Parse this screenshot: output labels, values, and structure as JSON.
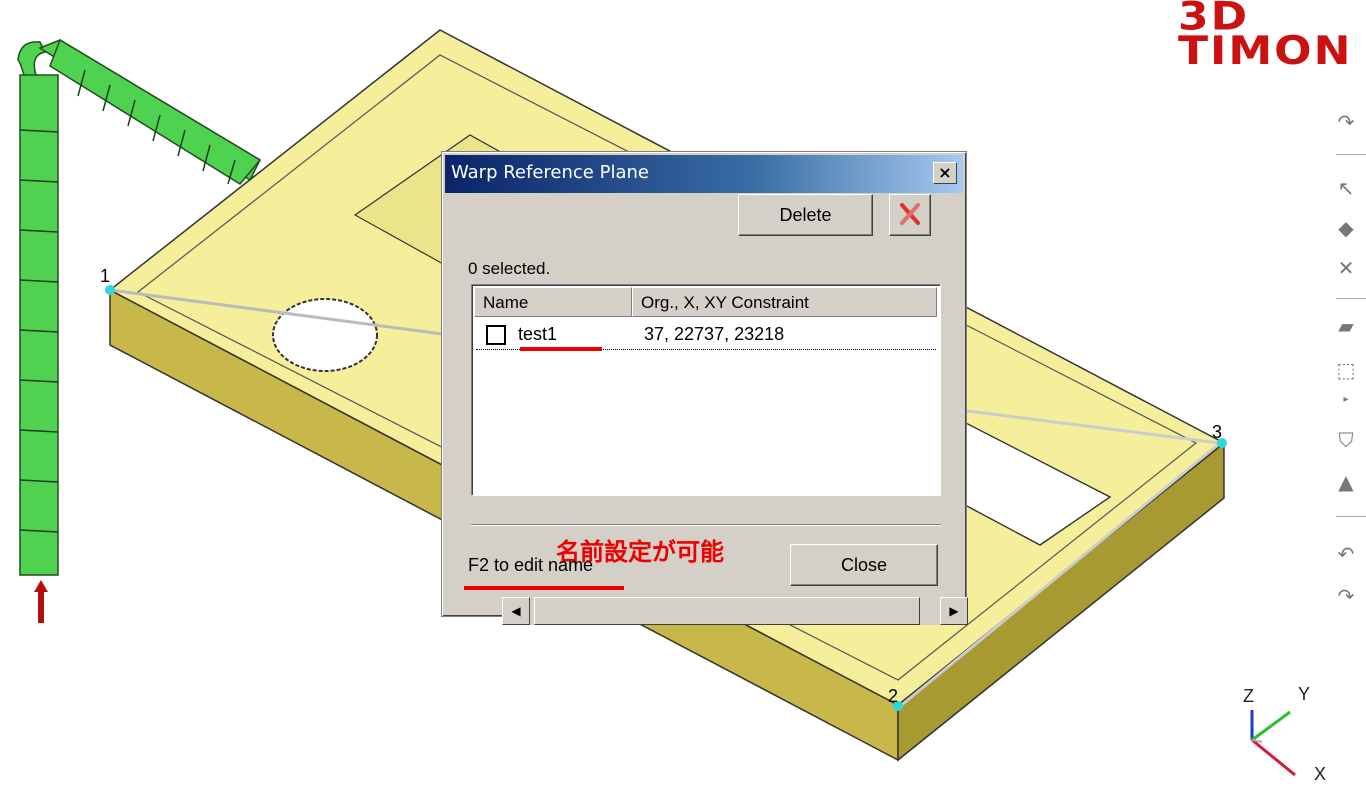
{
  "dialog": {
    "title": "Warp Reference Plane",
    "close_glyph": "×",
    "selection_status": "0 selected.",
    "delete_label": "Delete",
    "delete_all_icon": "red-x-icon",
    "columns": [
      "Name",
      "Org., X, XY Constraint"
    ],
    "rows": [
      {
        "name": "test1",
        "values": "37, 22737, 23218",
        "checked": false
      }
    ],
    "annotation": "名前設定が可能",
    "hint": "F2 to edit name",
    "close_label": "Close"
  },
  "viewport": {
    "logo": "3D TIMON",
    "corner_labels": [
      "1",
      "2",
      "3"
    ],
    "axes": {
      "z": "Z",
      "y": "Y",
      "x": "X"
    },
    "part_color": "#f5ee9b",
    "runner_color": "#4fd24f",
    "annotation_color": "#ee0000"
  },
  "toolbar": {
    "icons": [
      "rotate-icon",
      "pan-icon",
      "zoom-icon",
      "cross-icon",
      "box-icon",
      "select-icon",
      "small-arrow-icon",
      "filter-icon",
      "cone-icon",
      "undo-icon",
      "redo-icon"
    ]
  }
}
